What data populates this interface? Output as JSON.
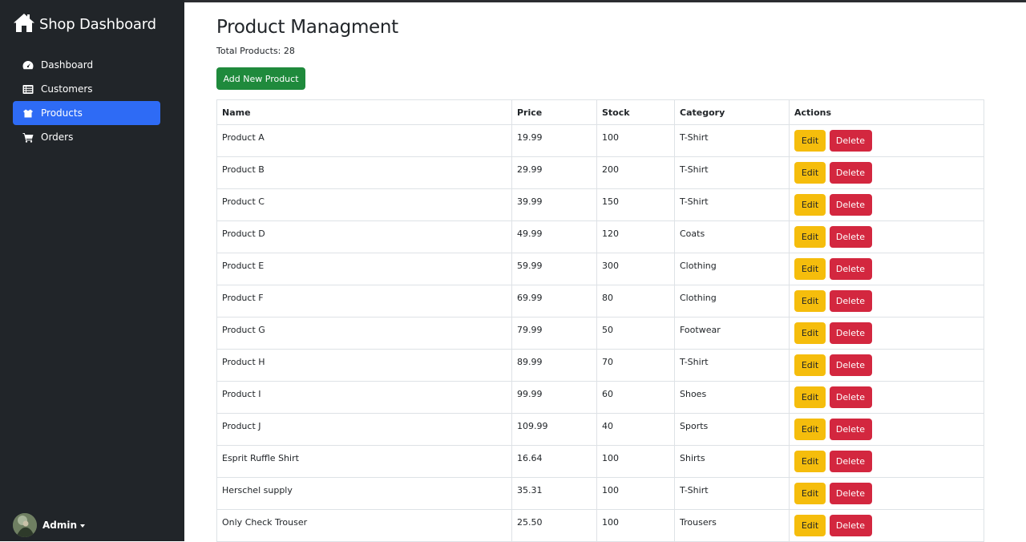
{
  "sidebar": {
    "brand": "Shop Dashboard",
    "items": [
      {
        "label": "Dashboard",
        "icon": "gauge-icon",
        "active": false
      },
      {
        "label": "Customers",
        "icon": "list-icon",
        "active": false
      },
      {
        "label": "Products",
        "icon": "box-icon",
        "active": true
      },
      {
        "label": "Orders",
        "icon": "cart-icon",
        "active": false
      }
    ],
    "user": "Admin"
  },
  "main": {
    "title": "Product Managment",
    "total": "Total Products: 28",
    "add_label": "Add New Product",
    "columns": [
      "Name",
      "Price",
      "Stock",
      "Category",
      "Actions"
    ],
    "edit_label": "Edit",
    "delete_label": "Delete",
    "rows": [
      {
        "name": "Product A",
        "price": "19.99",
        "stock": "100",
        "category": "T-Shirt"
      },
      {
        "name": "Product B",
        "price": "29.99",
        "stock": "200",
        "category": "T-Shirt"
      },
      {
        "name": "Product C",
        "price": "39.99",
        "stock": "150",
        "category": "T-Shirt"
      },
      {
        "name": "Product D",
        "price": "49.99",
        "stock": "120",
        "category": "Coats"
      },
      {
        "name": "Product E",
        "price": "59.99",
        "stock": "300",
        "category": "Clothing"
      },
      {
        "name": "Product F",
        "price": "69.99",
        "stock": "80",
        "category": "Clothing"
      },
      {
        "name": "Product G",
        "price": "79.99",
        "stock": "50",
        "category": "Footwear"
      },
      {
        "name": "Product H",
        "price": "89.99",
        "stock": "70",
        "category": "T-Shirt"
      },
      {
        "name": "Product I",
        "price": "99.99",
        "stock": "60",
        "category": "Shoes"
      },
      {
        "name": "Product J",
        "price": "109.99",
        "stock": "40",
        "category": "Sports"
      },
      {
        "name": "Esprit Ruffle Shirt",
        "price": "16.64",
        "stock": "100",
        "category": "Shirts"
      },
      {
        "name": "Herschel supply",
        "price": "35.31",
        "stock": "100",
        "category": "T-Shirt"
      },
      {
        "name": "Only Check Trouser",
        "price": "25.50",
        "stock": "100",
        "category": "Trousers"
      }
    ]
  },
  "colors": {
    "sidebar_bg": "#212529",
    "active_nav": "#2e6bf5",
    "add_button": "#1f8a3c",
    "edit_button": "#f5bd0c",
    "delete_button": "#d3273f"
  }
}
